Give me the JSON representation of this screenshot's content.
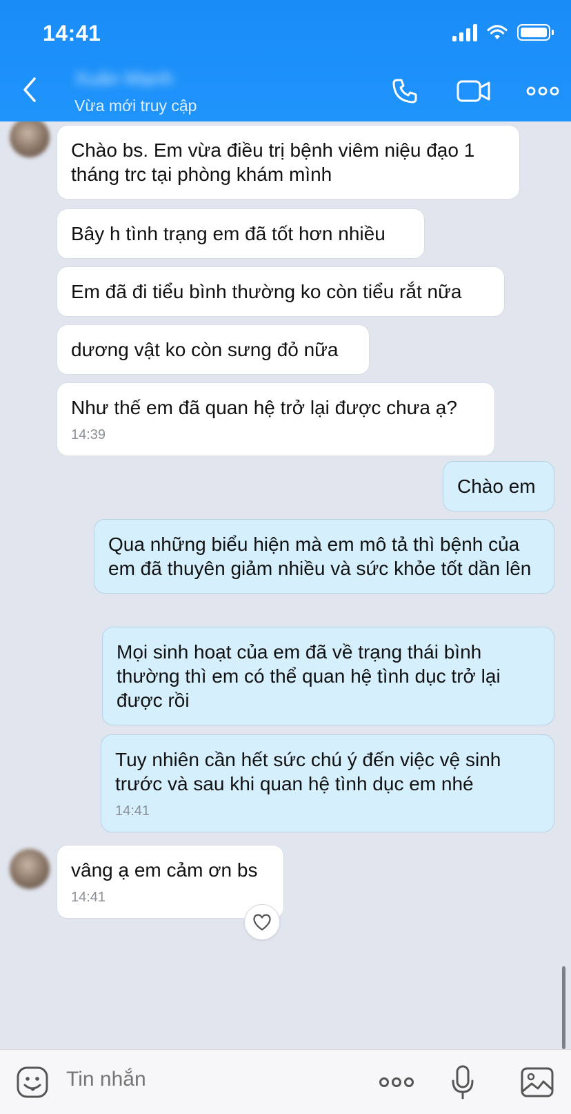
{
  "status_bar": {
    "time": "14:41"
  },
  "header": {
    "contact_name": "Xuân Mạnh",
    "contact_status": "Vừa mới truy cập",
    "icons": [
      "back-icon",
      "phone-icon",
      "video-icon",
      "more-icon"
    ]
  },
  "messages": [
    {
      "from": "them",
      "text": "Chào bs. Em vừa điều trị bệnh viêm niệu đạo 1 tháng trc tại phòng khám mình"
    },
    {
      "from": "them",
      "text": "Bây h tình trạng em đã tốt hơn nhiều"
    },
    {
      "from": "them",
      "text": "Em đã đi tiểu bình thường ko còn tiểu rắt nữa"
    },
    {
      "from": "them",
      "text": "dương vật ko còn sưng đỏ nữa"
    },
    {
      "from": "them",
      "text": "Như thế em đã quan hệ trở lại được chưa ạ?",
      "time": "14:39"
    },
    {
      "from": "me",
      "text": "Chào em"
    },
    {
      "from": "me",
      "text": "Qua những biểu hiện mà em mô tả thì bệnh của em đã thuyên giảm nhiều và sức khỏe tốt dần lên"
    },
    {
      "from": "me",
      "text": "Mọi sinh hoạt của em đã về trạng thái bình thường thì em có thể quan hệ tình dục trở lại được rồi"
    },
    {
      "from": "me",
      "text": "Tuy nhiên cần hết sức chú ý đến việc vệ sinh trước và sau khi quan hệ tình dục em nhé",
      "time": "14:41"
    },
    {
      "from": "them",
      "text": "vâng ạ em cảm ơn bs",
      "time": "14:41"
    }
  ],
  "input": {
    "placeholder": "Tin nhắn"
  },
  "colors": {
    "header": "#1a8cf7",
    "chat_bg": "#e1e5ee",
    "outgoing_bubble": "#d5effd",
    "incoming_bubble": "#ffffff"
  }
}
